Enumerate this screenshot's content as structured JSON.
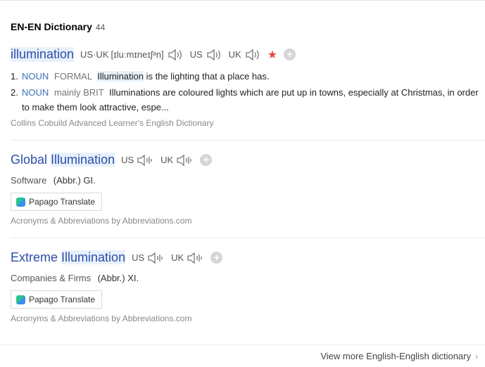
{
  "header": {
    "title": "EN-EN Dictionary",
    "count": "44"
  },
  "entry1": {
    "headword": "illumination",
    "pron_labels": {
      "usuk": "US·UK",
      "us": "US",
      "uk": "UK"
    },
    "ipa": "[ɪluːmɪneɪʃᵊn]",
    "senses": [
      {
        "num": "1.",
        "pos": "NOUN",
        "tag": "FORMAL",
        "hl": "Illumination",
        "text": " is the lighting that a place has."
      },
      {
        "num": "2.",
        "pos": "NOUN",
        "tag": "mainly BRIT",
        "hl": "",
        "text": "Illuminations are coloured lights which are put up in towns, especially at Christmas, in order to make them look attractive, espe..."
      }
    ],
    "source": "Collins Cobuild Advanced Learner's English Dictionary"
  },
  "entry2": {
    "word_plain": "Global ",
    "word_hl": "Illumination",
    "pron": {
      "us": "US",
      "uk": "UK"
    },
    "category": "Software",
    "abbr": "(Abbr.) GI.",
    "papago": "Papago Translate",
    "source": "Acronyms & Abbreviations by Abbreviations.com"
  },
  "entry3": {
    "word_plain": "Extreme ",
    "word_hl": "Illumination",
    "pron": {
      "us": "US",
      "uk": "UK"
    },
    "category": "Companies & Firms",
    "abbr": "(Abbr.) XI.",
    "papago": "Papago Translate",
    "source": "Acronyms & Abbreviations by Abbreviations.com"
  },
  "footer": {
    "more": "View more English-English dictionary"
  },
  "colors": {
    "link": "#2b4ea8",
    "pos": "#3d6fb8",
    "star": "#e64b3b",
    "highlight": "#e8f1fb"
  },
  "icons": [
    "speaker-icon",
    "speaker-wave-icon",
    "plus-icon",
    "star-icon",
    "papago-icon",
    "chevron-right-icon"
  ]
}
